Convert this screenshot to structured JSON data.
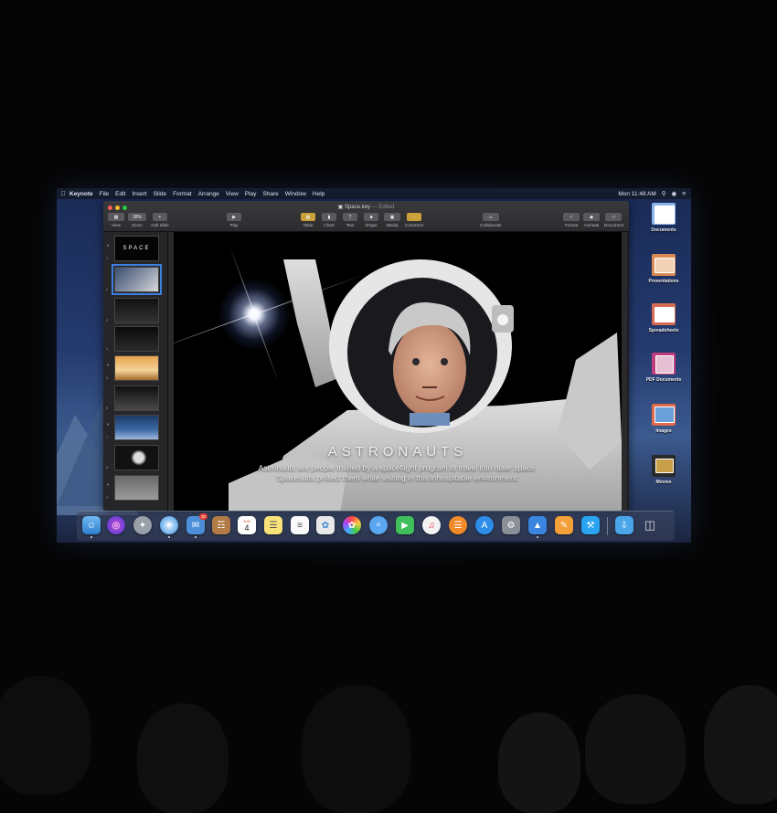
{
  "menubar": {
    "app_name": "Keynote",
    "items": [
      "File",
      "Edit",
      "Insert",
      "Slide",
      "Format",
      "Arrange",
      "View",
      "Play",
      "Share",
      "Window",
      "Help"
    ],
    "clock": "Mon 11:48 AM"
  },
  "window": {
    "doc_name": "Space.key",
    "doc_status": "— Edited",
    "toolbar": {
      "view": "View",
      "zoom_value": "38%",
      "zoom": "Zoom",
      "add_slide": "Add Slide",
      "play": "Play",
      "table": "Table",
      "chart": "Chart",
      "text": "Text",
      "shape": "Shape",
      "media": "Media",
      "comment": "Comment",
      "collaborate": "Collaborate",
      "format": "Format",
      "animate": "Animate",
      "document": "Document"
    }
  },
  "navigator": {
    "slides": [
      {
        "num": "1",
        "label": "SPACE"
      },
      {
        "num": "2",
        "label": ""
      },
      {
        "num": "3",
        "label": ""
      },
      {
        "num": "4",
        "label": ""
      },
      {
        "num": "5",
        "label": ""
      },
      {
        "num": "6",
        "label": ""
      },
      {
        "num": "7",
        "label": ""
      },
      {
        "num": "8",
        "label": ""
      },
      {
        "num": "9",
        "label": ""
      }
    ]
  },
  "slide": {
    "title": "ASTRONAUTS",
    "body_line1": "Astronauts are people trained by a spaceflight program to travel into outer space.",
    "body_line2": "Spacesuits protect them while visiting in this inhospitable environment."
  },
  "stacks": {
    "documents": "Documents",
    "presentations": "Presentations",
    "spreadsheets": "Spreadsheets",
    "pdf": "PDF Documents",
    "images": "Images",
    "movies": "Movies"
  },
  "dock": {
    "calendar_month": "JUN",
    "calendar_day": "4",
    "mail_badge": "30"
  },
  "colors": {
    "accent": "#3d7fe0",
    "menubar": "#141a28",
    "window": "#1e1e20"
  }
}
